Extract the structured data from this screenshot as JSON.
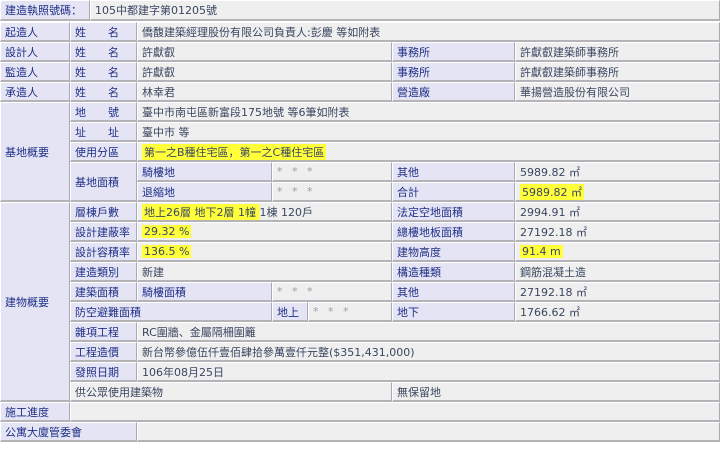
{
  "header": {
    "label": "建造執照號碼：",
    "value": "105中都建字第01205號"
  },
  "builder": {
    "label": "起造人",
    "name_label": "姓　　名",
    "name": "僑馥建築經理股份有限公司負責人:彭慶 等如附表"
  },
  "designer": {
    "label": "設計人",
    "name_label": "姓　　名",
    "name": "許獻叡",
    "office_label": "事務所",
    "office": "許獻叡建築師事務所"
  },
  "supervisor": {
    "label": "監造人",
    "name_label": "姓　　名",
    "name": "許獻叡",
    "office_label": "事務所",
    "office": "許獻叡建築師事務所"
  },
  "contractor": {
    "label": "承造人",
    "name_label": "姓　　名",
    "name": "林幸君",
    "company_label": "營造廠",
    "company": "華揚營造股份有限公司"
  },
  "site": {
    "label": "基地概要",
    "lot_label": "地　　號",
    "lot": "臺中市南屯區新富段175地號 等6筆如附表",
    "address_label": "址　　址",
    "address": "臺中市 等",
    "zoning_label": "使用分區",
    "zoning": "第一之B種住宅區，第一之C種住宅區",
    "area_label": "基地面積",
    "arcade_label": "騎樓地",
    "arcade": "* * *",
    "other_label": "其他",
    "other": "5989.82 ㎡",
    "setback_label": "退縮地",
    "setback": "* * *",
    "total_label": "合計",
    "total": "5989.82 ㎡"
  },
  "building": {
    "label": "建物概要",
    "floors_label": "層棟戶數",
    "floors": "地上26層 地下2層 1幢 1棟 120戶",
    "open_space_label": "法定空地面積",
    "open_space": "2994.91 ㎡",
    "coverage_label": "設計建蔽率",
    "coverage": "29.32 %",
    "total_floor_label": "總樓地板面積",
    "total_floor": "27192.18 ㎡",
    "far_label": "設計容積率",
    "far": "136.5 %",
    "height_label": "建物高度",
    "height": "91.4 m",
    "category_label": "建造類別",
    "category": "新建",
    "structure_label": "構造種類",
    "structure": "鋼筋混凝土造",
    "area_label": "建築面積",
    "arcade_area_label": "騎樓面積",
    "arcade_area": "* * *",
    "other_label": "其他",
    "other": "27192.18 ㎡",
    "shelter_label": "防空避難面積",
    "above_label": "地上",
    "above": "* * *",
    "below_label": "地下",
    "below": "1766.62 ㎡",
    "misc_label": "雜項工程",
    "misc": "RC圍牆、金屬隔柵圍籬",
    "cost_label": "工程造價",
    "cost": "新台幣參億伍仟壹佰肆拾參萬壹仟元整($351,431,000)",
    "date_label": "發照日期",
    "date": "106年08月25日",
    "public_label": "供公眾使用建築物",
    "reserve": "無保留地"
  },
  "progress": {
    "label": "施工進度",
    "value": ""
  },
  "committee": {
    "label": "公寓大廈管委會",
    "value": ""
  }
}
